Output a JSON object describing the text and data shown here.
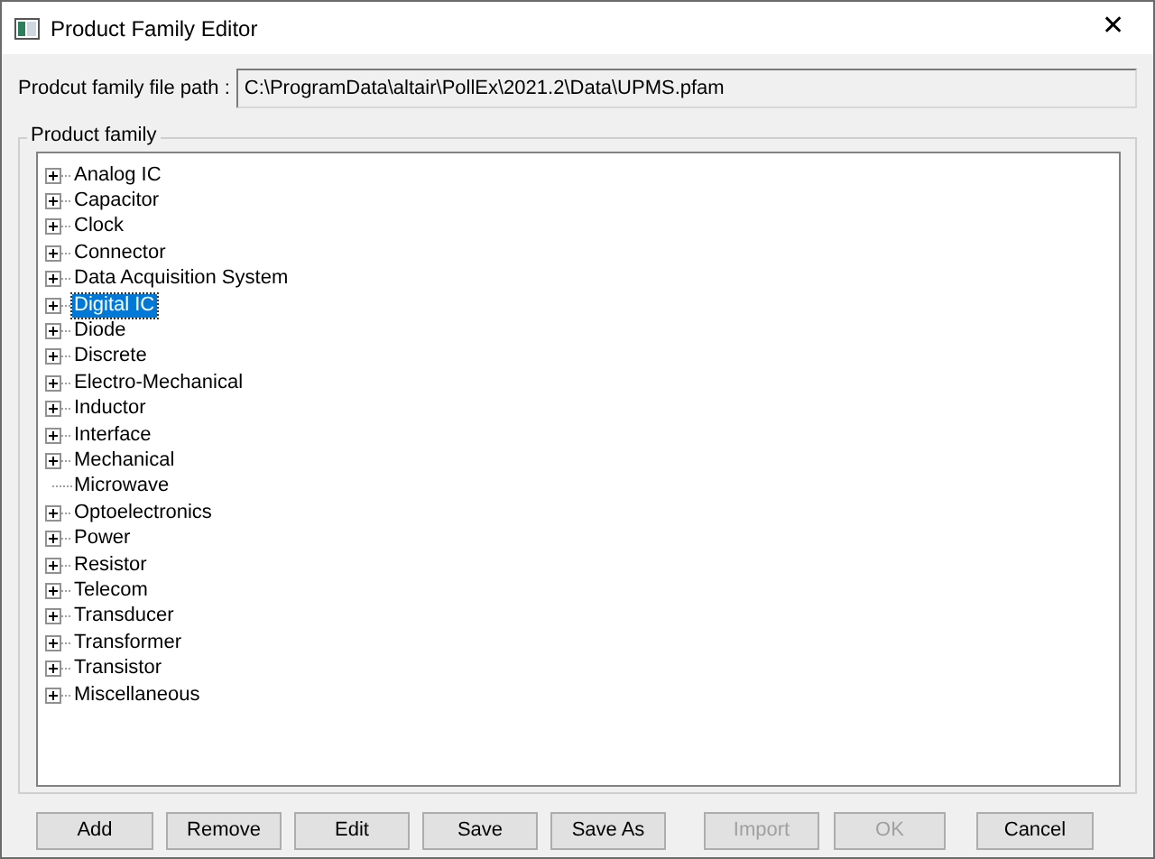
{
  "window": {
    "title": "Product Family Editor",
    "close": "✕"
  },
  "path": {
    "label": "Prodcut family file path :",
    "value": "C:\\ProgramData\\altair\\PollEx\\2021.2\\Data\\UPMS.pfam"
  },
  "group": {
    "title": "Product family"
  },
  "tree": [
    {
      "label": "Analog IC",
      "kind": "folder",
      "selected": false
    },
    {
      "label": "Capacitor",
      "kind": "folder",
      "selected": false
    },
    {
      "label": "Clock",
      "kind": "folder",
      "selected": false
    },
    {
      "label": "Connector",
      "kind": "folder",
      "selected": false
    },
    {
      "label": "Data Acquisition System",
      "kind": "folder",
      "selected": false
    },
    {
      "label": "Digital IC",
      "kind": "folder",
      "selected": true
    },
    {
      "label": "Diode",
      "kind": "folder",
      "selected": false
    },
    {
      "label": "Discrete",
      "kind": "folder",
      "selected": false
    },
    {
      "label": "Electro-Mechanical",
      "kind": "folder",
      "selected": false
    },
    {
      "label": "Inductor",
      "kind": "folder",
      "selected": false
    },
    {
      "label": "Interface",
      "kind": "folder",
      "selected": false
    },
    {
      "label": "Mechanical",
      "kind": "folder",
      "selected": false
    },
    {
      "label": "Microwave",
      "kind": "leaf",
      "selected": false
    },
    {
      "label": "Optoelectronics",
      "kind": "folder",
      "selected": false
    },
    {
      "label": "Power",
      "kind": "folder",
      "selected": false
    },
    {
      "label": "Resistor",
      "kind": "folder",
      "selected": false
    },
    {
      "label": "Telecom",
      "kind": "folder",
      "selected": false
    },
    {
      "label": "Transducer",
      "kind": "folder",
      "selected": false
    },
    {
      "label": "Transformer",
      "kind": "folder",
      "selected": false
    },
    {
      "label": "Transistor",
      "kind": "folder",
      "selected": false
    },
    {
      "label": "Miscellaneous",
      "kind": "folder",
      "selected": false
    }
  ],
  "buttons": [
    {
      "label": "Add",
      "disabled": false
    },
    {
      "label": "Remove",
      "disabled": false
    },
    {
      "label": "Edit",
      "disabled": false
    },
    {
      "label": "Save",
      "disabled": false
    },
    {
      "label": "Save As",
      "disabled": false
    },
    {
      "label": "Import",
      "disabled": true
    },
    {
      "label": "OK",
      "disabled": true
    },
    {
      "label": "Cancel",
      "disabled": false
    }
  ]
}
